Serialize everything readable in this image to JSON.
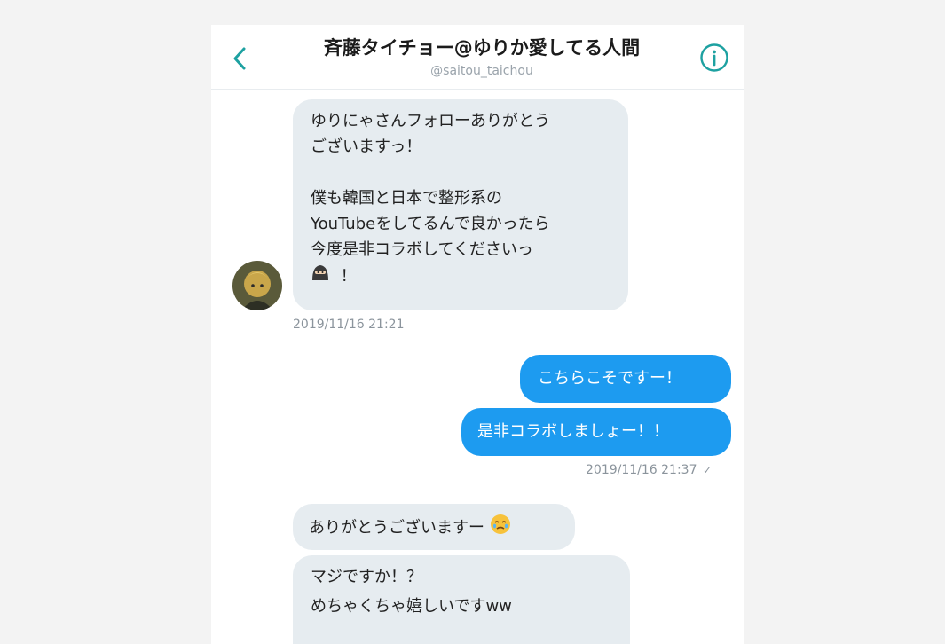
{
  "header": {
    "title": "斉藤タイチョー@ゆりか愛してる人間",
    "handle": "@saitou_taichou",
    "back_icon": "chevron-left-icon",
    "info_icon": "info-icon",
    "accent_color": "#1da1a1"
  },
  "messages": {
    "msg1": {
      "lines": [
        "ゆりにゃさんフォローありがとう",
        "ございますっ！",
        "",
        "僕も韓国と日本で整形系の",
        "YouTubeをしてるんで良かったら",
        "今度是非コラボしてくださいっ"
      ],
      "last_line_suffix": "！",
      "emoji": "ninja-emoji-icon",
      "timestamp": "2019/11/16 21:21"
    },
    "msg2": {
      "text": "こちらこそですー！"
    },
    "msg3": {
      "text": "是非コラボしましょー！！",
      "timestamp": "2019/11/16 21:37",
      "read_mark": "✓"
    },
    "msg4": {
      "text": "ありがとうございますー",
      "emoji": "tearful-face-emoji-icon"
    },
    "msg5": {
      "lines": [
        "マジですか！？",
        "めちゃくちゃ嬉しいですww"
      ]
    }
  },
  "colors": {
    "incoming_bubble": "#e6ecf0",
    "outgoing_bubble": "#1d9bf0",
    "timestamp": "#8b949c"
  }
}
